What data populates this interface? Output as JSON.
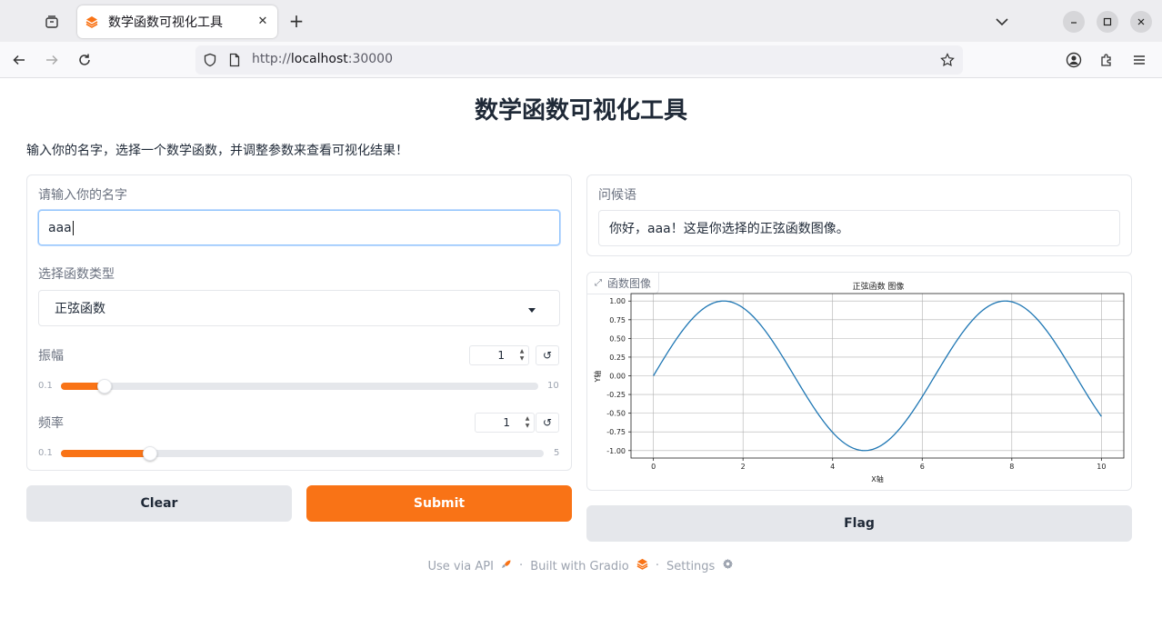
{
  "browser": {
    "tab_title": "数学函数可视化工具",
    "url_prefix": "http://",
    "url_host": "localhost",
    "url_port": ":30000"
  },
  "page": {
    "title": "数学函数可视化工具",
    "description": "输入你的名字，选择一个数学函数，并调整参数来查看可视化结果！"
  },
  "inputs": {
    "name_label": "请输入你的名字",
    "name_value": "aaa",
    "func_label": "选择函数类型",
    "func_value": "正弦函数",
    "amplitude": {
      "label": "振幅",
      "value": "1",
      "min": "0.1",
      "max": "10",
      "fraction": 0.0909
    },
    "frequency": {
      "label": "频率",
      "value": "1",
      "min": "0.1",
      "max": "5",
      "fraction": 0.1837
    },
    "reset_glyph": "↺"
  },
  "buttons": {
    "clear": "Clear",
    "submit": "Submit",
    "flag": "Flag"
  },
  "outputs": {
    "greeting_label": "问候语",
    "greeting_value": "你好，aaa！这是你选择的正弦函数图像。",
    "plot_label": "函数图像"
  },
  "footer": {
    "api": "Use via API",
    "built": "Built with Gradio",
    "settings": "Settings",
    "separator": "·"
  },
  "colors": {
    "accent": "#f97316",
    "line": "#1f77b4"
  },
  "chart_data": {
    "type": "line",
    "title": "正弦函数 图像",
    "xlabel": "X轴",
    "ylabel": "Y轴",
    "xlim": [
      -0.5,
      10.5
    ],
    "ylim": [
      -1.1,
      1.1
    ],
    "xticks": [
      0,
      2,
      4,
      6,
      8,
      10
    ],
    "yticks": [
      -1.0,
      -0.75,
      -0.5,
      -0.25,
      0.0,
      0.25,
      0.5,
      0.75,
      1.0
    ],
    "grid": true,
    "function": "sin",
    "amplitude": 1,
    "frequency": 1,
    "x_range": [
      0,
      10
    ]
  }
}
